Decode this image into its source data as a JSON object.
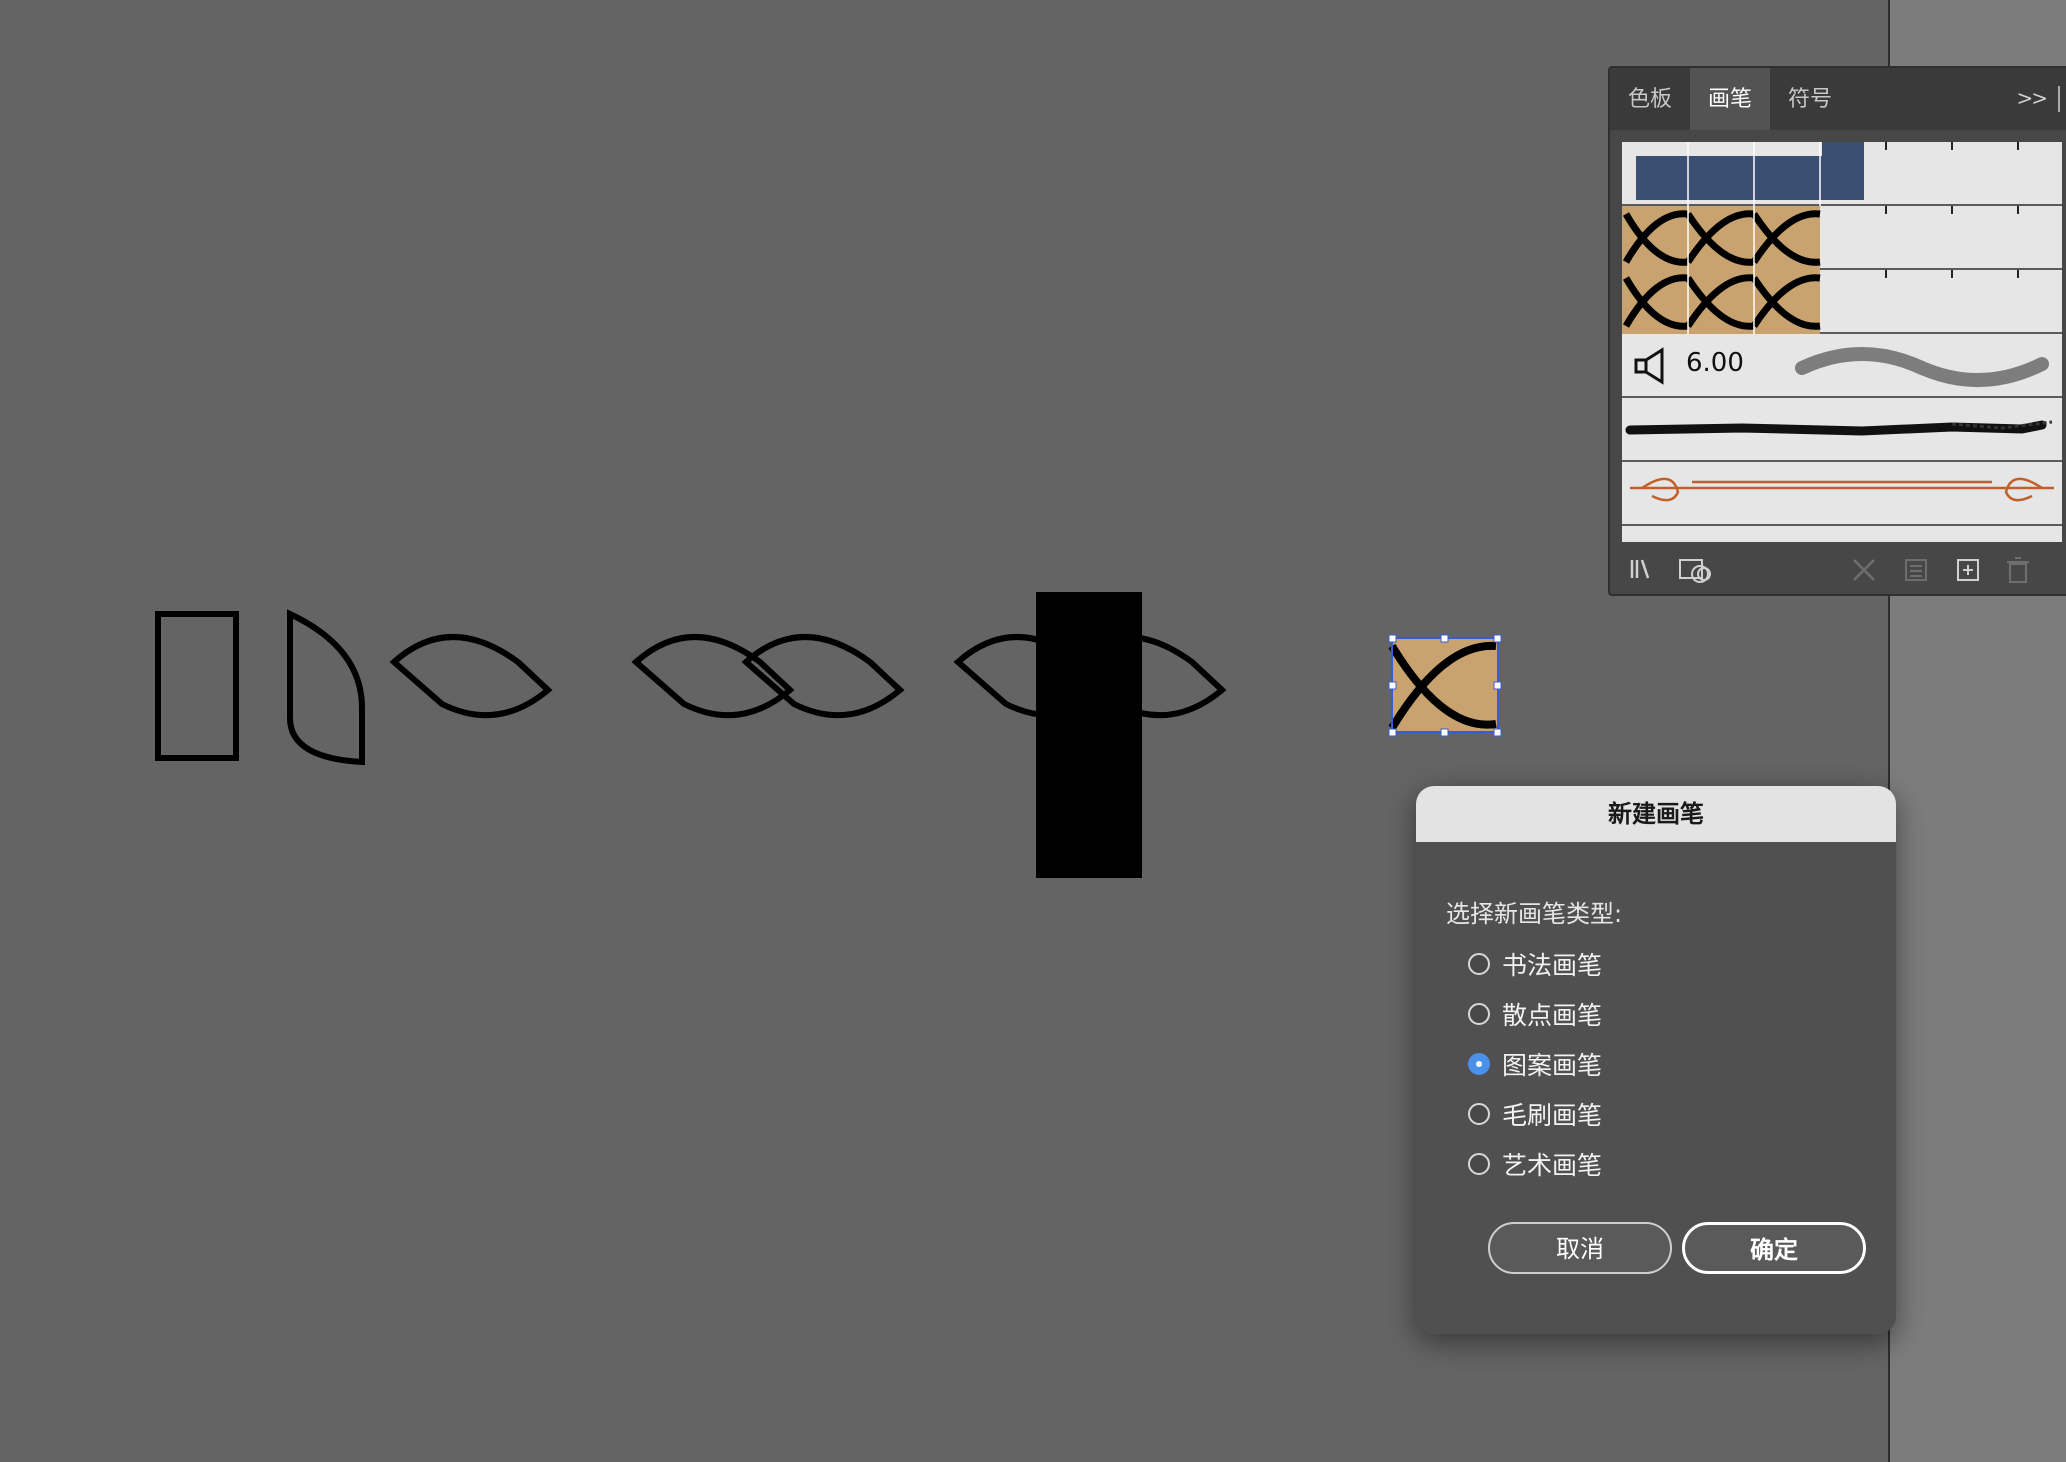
{
  "panel": {
    "tabs": [
      {
        "label": "色板",
        "active": false
      },
      {
        "label": "画笔",
        "active": true
      },
      {
        "label": "符号",
        "active": false
      }
    ],
    "more_icon": "double-chevron-right-icon",
    "calligraphic_size": "6.00",
    "footer_icons": [
      "brush-libraries-icon",
      "cc-libraries-icon",
      "remove-stroke-icon",
      "options-icon",
      "new-brush-icon",
      "delete-icon"
    ]
  },
  "dialog": {
    "title": "新建画笔",
    "prompt": "选择新画笔类型:",
    "options": [
      {
        "label": "书法画笔",
        "checked": false
      },
      {
        "label": "散点画笔",
        "checked": false
      },
      {
        "label": "图案画笔",
        "checked": true
      },
      {
        "label": "毛刷画笔",
        "checked": false
      },
      {
        "label": "艺术画笔",
        "checked": false
      }
    ],
    "cancel_label": "取消",
    "ok_label": "确定"
  },
  "colors": {
    "canvas": "#646464",
    "tan_fill": "#c9a36f",
    "accent_blue": "#4a8fe8",
    "selection_blue": "#3a5bd6"
  }
}
